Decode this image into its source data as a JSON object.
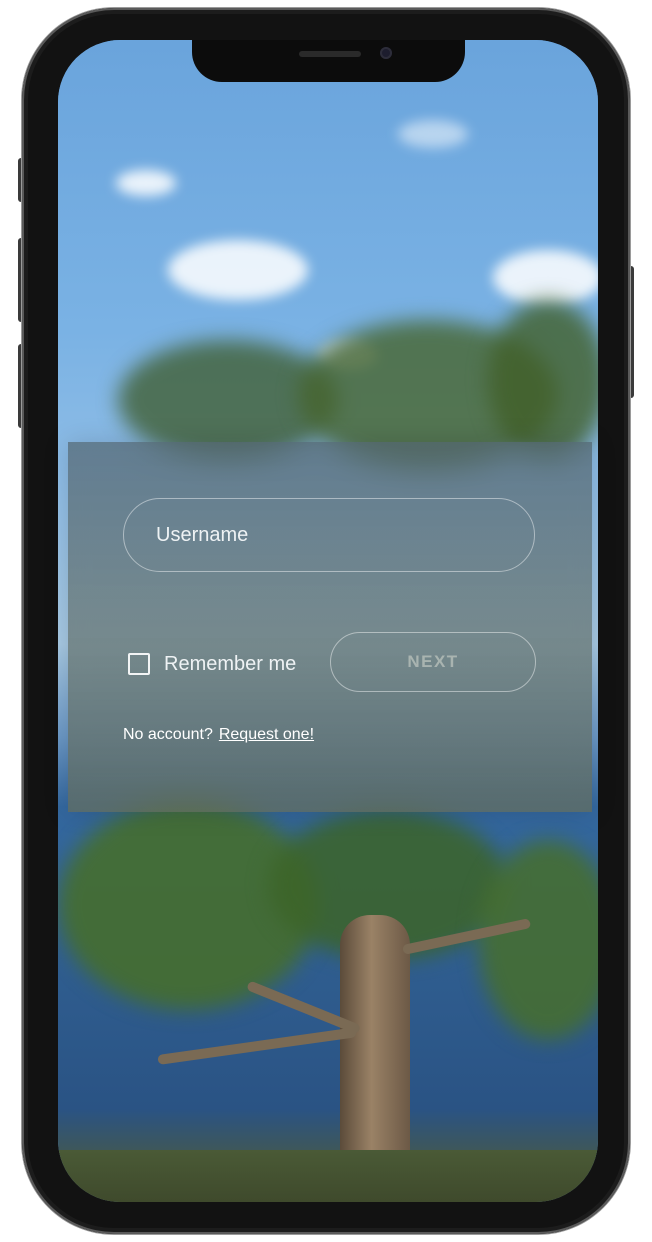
{
  "login": {
    "username_placeholder": "Username",
    "remember_label": "Remember me",
    "remember_checked": false,
    "next_label": "NEXT",
    "no_account_text": "No account?",
    "request_link": "Request one!"
  },
  "colors": {
    "text": "#eef2f4",
    "button_text_disabled": "#ebebe1"
  }
}
